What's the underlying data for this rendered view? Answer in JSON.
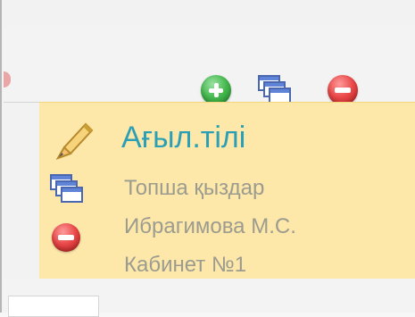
{
  "toolbar": {
    "add_icon": "green-plus-circle",
    "windows_icon": "stacked-windows",
    "remove_icon": "red-minus-circle"
  },
  "lesson": {
    "title": "Ағыл.тілі",
    "group": "Топша қыздар",
    "teacher": "Ибрагимова М.С.",
    "room": "Кабинет №1"
  },
  "colors": {
    "panel_bg": "#fde8a9",
    "title": "#2a9fb6",
    "detail_text": "#9b9b8f"
  }
}
